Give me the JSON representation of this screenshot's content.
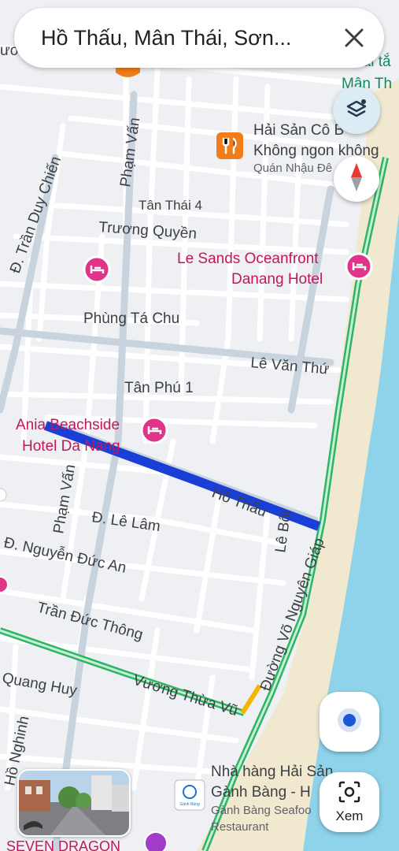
{
  "search": {
    "query": "Hồ Thấu, Mân Thái, Sơn..."
  },
  "colors": {
    "route": "#1a3fd6",
    "poi_hotel": "#e0338a",
    "poi_food": "#f07d1a",
    "highway": "#2fb365",
    "sea": "#8ed3ea",
    "sand": "#f1e9cf"
  },
  "roads": {
    "pham_van_top": "Phạm Vấn",
    "tran_duy_chien": "Đ. Trần Duy Chiến",
    "tan_thai_4": "Tân Thái 4",
    "truong_quyen": "Trương Quyền",
    "phung_ta_chu": "Phùng Tá Chu",
    "le_van_thu": "Lê Văn Thứ",
    "tan_phu_1": "Tân Phú 1",
    "ho_thau": "Hồ Thấu",
    "pham_van_bottom": "Phạm Vấn",
    "le_lam": "Đ. Lê Lâm",
    "le_boi": "Lê Bôi",
    "nguyen_duc_an": "Đ. Nguyễn Đức An",
    "vo_nguyen_giap": "Đường Võ Nguyên Giáp",
    "tran_duc_thong": "Trần Đức Thông",
    "quang_huy": "Quang Huy",
    "vuong_thua_vu": "Vương Thừa Vũ",
    "ho_nghinh": "Hồ Nghinh",
    "top_left_partial": "ương",
    "top_right_partial_1": "Bãi tắ",
    "top_right_partial_2": "Mân Th"
  },
  "pois": {
    "hai_san": {
      "line1": "Hải Sản Cô B",
      "line2": "Không ngon không",
      "sub": "Quán Nhậu Đê",
      "icon": "fork-knife-icon"
    },
    "le_sands": {
      "line1": "Le Sands Oceanfront",
      "line2": "Danang Hotel",
      "icon": "bed-icon"
    },
    "ania": {
      "line1": "Ania Beachside",
      "line2": "Hotel Da Nang",
      "icon": "bed-icon"
    },
    "ganh_bang": {
      "line1": "Nhà hàng Hải Sản",
      "line2": "Gành Bàng - H",
      "sub1": "Gành Bàng Seafoo",
      "sub2": "Restaurant",
      "logo_text": "Gành Bàng"
    },
    "seven_dragon": {
      "label": "SEVEN DRAGON"
    }
  },
  "controls": {
    "lens_label": "Xem",
    "layers_icon": "layers-icon",
    "compass_icon": "compass-icon",
    "locate_icon": "my-location-icon",
    "close_icon": "close-icon"
  }
}
